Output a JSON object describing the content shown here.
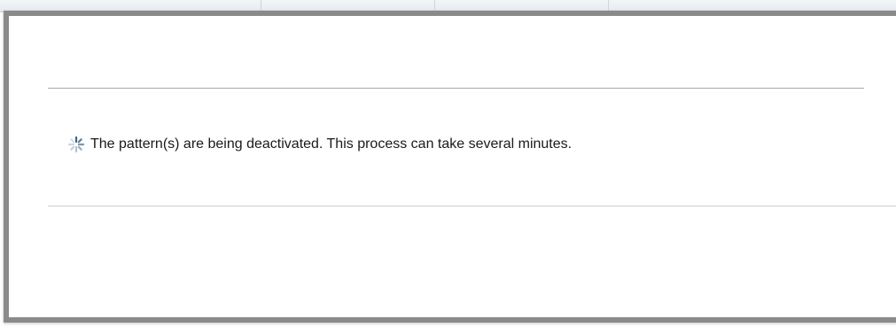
{
  "dialog": {
    "status_icon": "loading-spinner-icon",
    "message": "The pattern(s) are being deactivated. This process can take several minutes."
  },
  "colors": {
    "spinner_dark": "#4a6f8f",
    "spinner_light": "#b9c7d3",
    "frame": "#8a8a8a"
  }
}
